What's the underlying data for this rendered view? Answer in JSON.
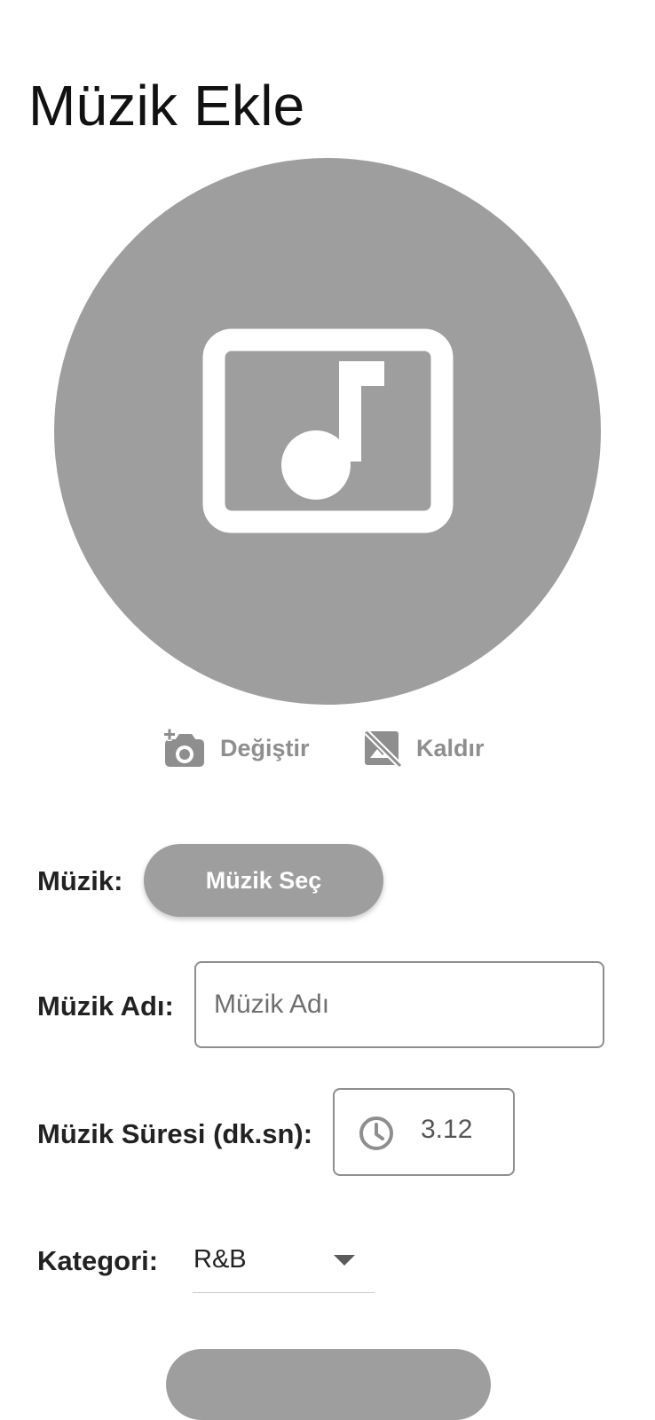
{
  "header": {
    "title": "Müzik Ekle"
  },
  "cover": {
    "icon": "music-note-image-icon",
    "background_color": "#9e9e9e",
    "icon_color": "#ffffff"
  },
  "cover_actions": {
    "change": {
      "label": "Değiştir",
      "icon": "add-camera-icon"
    },
    "remove": {
      "label": "Kaldır",
      "icon": "image-off-icon"
    },
    "color": "#8e8e8e"
  },
  "form": {
    "music": {
      "label": "Müzik:",
      "button_label": "Müzik Seç"
    },
    "name": {
      "label": "Müzik Adı:",
      "placeholder": "Müzik Adı",
      "value": ""
    },
    "duration": {
      "label": "Müzik Süresi (dk.sn):",
      "icon": "clock-icon",
      "value": "3.12"
    },
    "category": {
      "label": "Kategori:",
      "selected": "R&B",
      "icon": "dropdown-arrow-icon"
    }
  },
  "colors": {
    "accent_gray": "#9e9e9e",
    "text_dark": "#222222"
  }
}
